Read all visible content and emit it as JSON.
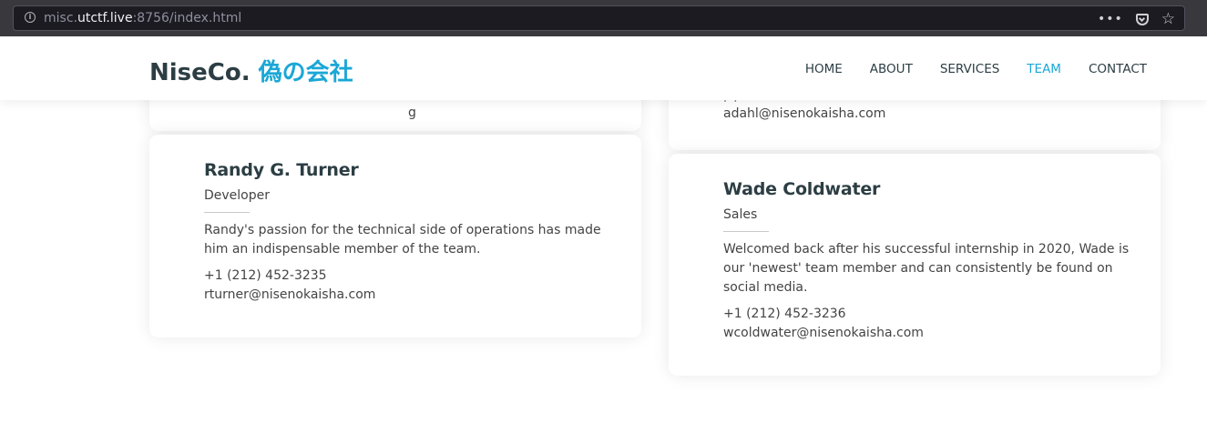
{
  "browser": {
    "url_prefix": "misc.",
    "url_host": "utctf.live",
    "url_suffix": ":8756/index.html",
    "more_icon": "more-horizontal-icon",
    "pocket_icon": "pocket-icon",
    "bookmark_icon": "star-icon"
  },
  "header": {
    "logo_text": "NiseCo.",
    "logo_accent": "偽の会社",
    "nav": [
      "HOME",
      "ABOUT",
      "SERVICES",
      "TEAM",
      "CONTACT"
    ],
    "active_nav": "TEAM",
    "accent_color": "#1aa7d6"
  },
  "cards": {
    "partial_left": {
      "fragment": "g"
    },
    "partial_right": {
      "phone_fragment": "(   )",
      "email": "adahl@nisenokaisha.com"
    },
    "randy": {
      "name": "Randy G. Turner",
      "role": "Developer",
      "description": "Randy's passion for the technical side of operations has made him an indispensable member of the team.",
      "phone": "+1 (212) 452-3235",
      "email": "rturner@nisenokaisha.com"
    },
    "wade": {
      "name": "Wade Coldwater",
      "role": "Sales",
      "description": "Welcomed back after his successful internship in 2020, Wade is our 'newest' team member and can consistently be found on social media.",
      "phone": "+1 (212) 452-3236",
      "email": "wcoldwater@nisenokaisha.com"
    }
  }
}
